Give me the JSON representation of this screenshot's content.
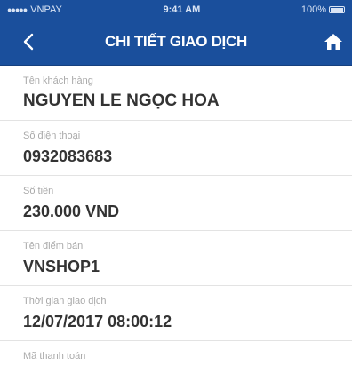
{
  "status_bar": {
    "carrier": "VNPAY",
    "time": "9:41 AM",
    "battery": "100%",
    "battery_level": 1.0
  },
  "header": {
    "title": "CHI TIẾT GIAO DỊCH",
    "back_icon": "chevron-left-icon",
    "home_icon": "home-icon",
    "background_color": "#1a4f9c"
  },
  "fields": [
    {
      "label": "Tên khách hàng",
      "value": "NGUYEN LE NGỌC HOA"
    },
    {
      "label": "Số điện thoại",
      "value": "0932083683"
    },
    {
      "label": "Số tiền",
      "value": "230.000 VND"
    },
    {
      "label": "Tên điểm bán",
      "value": "VNSHOP1"
    },
    {
      "label": "Thời gian giao dịch",
      "value": "12/07/2017  08:00:12"
    },
    {
      "label": "Mã thanh toán",
      "value": ""
    }
  ]
}
